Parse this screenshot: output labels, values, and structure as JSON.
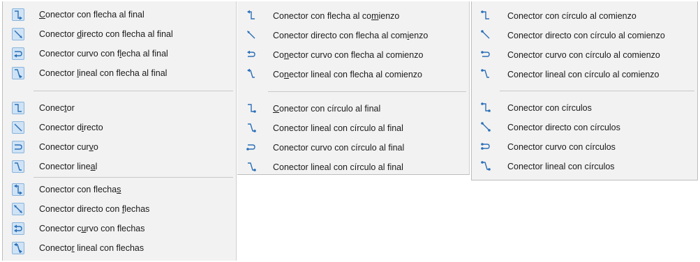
{
  "menus": [
    {
      "groups": [
        {
          "items": [
            {
              "label": "Conector con flecha al final",
              "accel": 0,
              "icon": "connector-arrow-end-icon"
            },
            {
              "label": "Conector directo con flecha al final",
              "accel": 9,
              "icon": "straight-connector-arrow-end-icon"
            },
            {
              "label": "Conector curvo con flecha al final",
              "accel": 20,
              "icon": "curved-connector-arrow-end-icon"
            },
            {
              "label": "Conector lineal con flecha al final",
              "accel": 9,
              "icon": "line-connector-arrow-end-icon"
            }
          ]
        },
        {
          "items": [
            {
              "label": "Conector",
              "accel": 5,
              "icon": "connector-icon"
            },
            {
              "label": "Conector directo",
              "accel": 10,
              "icon": "straight-connector-icon"
            },
            {
              "label": "Conector curvo",
              "accel": 12,
              "icon": "curved-connector-icon"
            },
            {
              "label": "Conector lineal",
              "accel": 13,
              "icon": "line-connector-icon"
            }
          ]
        },
        {
          "items": [
            {
              "label": "Conector con flechas",
              "accel": 19,
              "icon": "connector-arrows-icon"
            },
            {
              "label": "Conector directo con flechas",
              "accel": 21,
              "icon": "straight-connector-arrows-icon"
            },
            {
              "label": "Conector curvo con flechas",
              "accel": 10,
              "icon": "curved-connector-arrows-icon"
            },
            {
              "label": "Conector lineal con flechas",
              "accel": 7,
              "icon": "line-connector-arrows-icon"
            }
          ]
        }
      ]
    },
    {
      "groups": [
        {
          "items": [
            {
              "label": "Conector con flecha al comienzo",
              "accel": 25,
              "icon": "connector-arrow-start-icon"
            },
            {
              "label": "Conector directo con flecha al comienzo",
              "accel": 34,
              "icon": "straight-connector-arrow-start-icon"
            },
            {
              "label": "Conector curvo con flecha al comienzo",
              "accel": 2,
              "icon": "curved-connector-arrow-start-icon"
            },
            {
              "label": "Conector lineal con flecha al comienzo",
              "accel": 2,
              "icon": "line-connector-arrow-start-icon"
            }
          ]
        },
        {
          "items": [
            {
              "label": "Conector con círculo al final",
              "accel": 0,
              "icon": "connector-circle-end-icon"
            },
            {
              "label": "Conector lineal con círculo al final",
              "accel": -1,
              "icon": "line-connector-circle-end-icon"
            },
            {
              "label": "Conector curvo con círculo al final",
              "accel": -1,
              "icon": "curved-connector-circle-end-icon"
            },
            {
              "label": "Conector lineal con círculo al final",
              "accel": -1,
              "icon": "line-connector-circle-end-icon-2"
            }
          ]
        }
      ]
    },
    {
      "groups": [
        {
          "items": [
            {
              "label": "Conector con círculo al comienzo",
              "accel": -1,
              "icon": "connector-circle-start-icon"
            },
            {
              "label": "Conector directo con círculo al comienzo",
              "accel": -1,
              "icon": "straight-connector-circle-start-icon"
            },
            {
              "label": "Conector curvo con círculo al comienzo",
              "accel": -1,
              "icon": "curved-connector-circle-start-icon"
            },
            {
              "label": "Conector lineal con círculo al comienzo",
              "accel": -1,
              "icon": "line-connector-circle-start-icon"
            }
          ]
        },
        {
          "items": [
            {
              "label": "Conector con círculos",
              "accel": -1,
              "icon": "connector-circles-icon"
            },
            {
              "label": "Conector directo con círculos",
              "accel": -1,
              "icon": "straight-connector-circles-icon"
            },
            {
              "label": "Conector curvo con círculos",
              "accel": -1,
              "icon": "curved-connector-circles-icon"
            },
            {
              "label": "Conector lineal con círculos",
              "accel": -1,
              "icon": "line-connector-circles-icon"
            }
          ]
        }
      ]
    }
  ]
}
